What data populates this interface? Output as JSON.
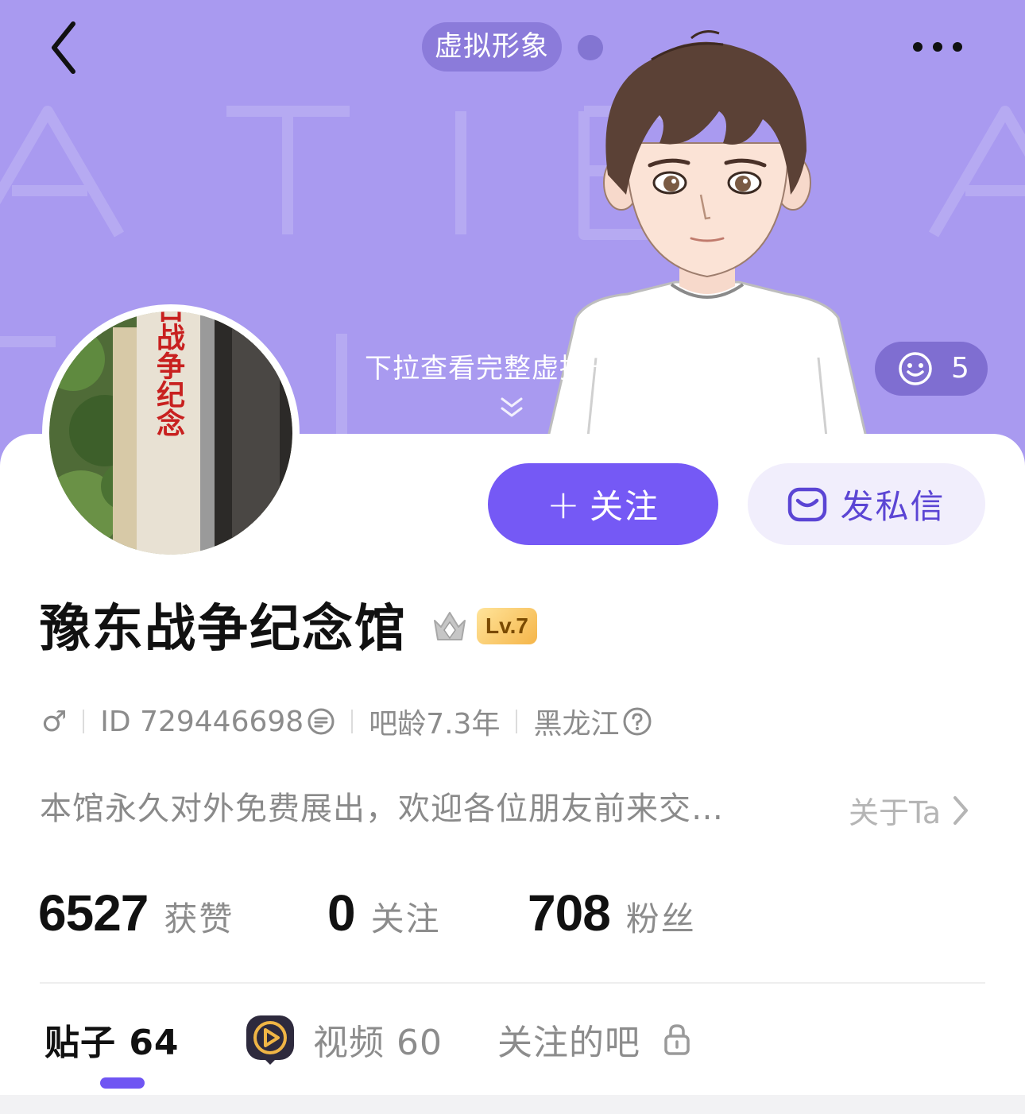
{
  "header": {
    "avatar_chip": "虚拟形象",
    "pull_hint": "下拉查看完整虚拟形象",
    "like_count": "5"
  },
  "profile": {
    "username": "豫东战争纪念馆",
    "level": "Lv.7",
    "gender_symbol": "♂",
    "id_text": "ID 729446698",
    "age_text": "吧龄7.3年",
    "location": "黑龙江",
    "bio": "本馆永久对外免费展出，欢迎各位朋友前来交…",
    "about_label": "关于Ta",
    "avatar_sign_text": "抗日战争纪念"
  },
  "actions": {
    "follow_plus": "+",
    "follow_label": "关注",
    "message_label": "发私信"
  },
  "stats": [
    {
      "value": "6527",
      "label": "获赞"
    },
    {
      "value": "0",
      "label": "关注"
    },
    {
      "value": "708",
      "label": "粉丝"
    }
  ],
  "tabs": [
    {
      "label": "贴子 64"
    },
    {
      "label": "视频 60"
    },
    {
      "label": "关注的吧"
    }
  ],
  "colors": {
    "banner": "#a99af0",
    "accent": "#7559f5",
    "secondary_button_bg": "#f1eefc"
  },
  "icons": [
    "back-arrow-icon",
    "more-icon",
    "smile-icon",
    "mail-icon",
    "crown-icon",
    "copy-icon",
    "help-icon",
    "chevron-right-icon",
    "video-play-icon",
    "lock-icon",
    "double-chevron-down-icon"
  ]
}
